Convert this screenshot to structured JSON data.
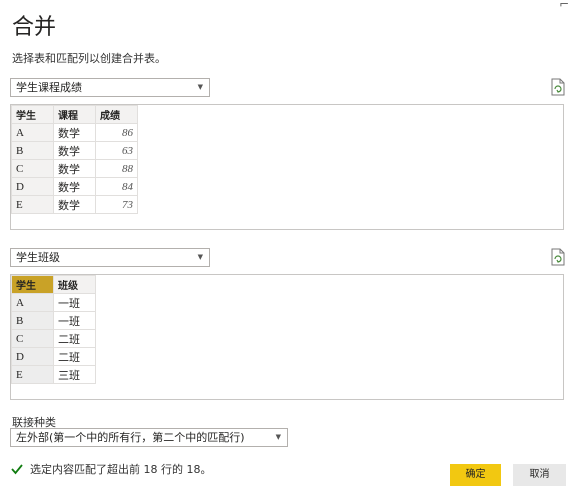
{
  "dialog": {
    "title": "合并",
    "subtitle": "选择表和匹配列以创建合并表。"
  },
  "table1": {
    "dropdown_value": "学生课程成绩",
    "columns": [
      "学生",
      "课程",
      "成绩"
    ],
    "rows": [
      [
        "A",
        "数学",
        "86"
      ],
      [
        "B",
        "数学",
        "63"
      ],
      [
        "C",
        "数学",
        "88"
      ],
      [
        "D",
        "数学",
        "84"
      ],
      [
        "E",
        "数学",
        "73"
      ]
    ]
  },
  "table2": {
    "dropdown_value": "学生班级",
    "columns": [
      "学生",
      "班级"
    ],
    "rows": [
      [
        "A",
        "一班"
      ],
      [
        "B",
        "一班"
      ],
      [
        "C",
        "二班"
      ],
      [
        "D",
        "二班"
      ],
      [
        "E",
        "三班"
      ]
    ]
  },
  "join": {
    "label": "联接种类",
    "value": "左外部(第一个中的所有行，第二个中的匹配行)"
  },
  "status": {
    "text": "选定内容匹配了超出前 18 行的 18。"
  },
  "buttons": {
    "ok": "确定",
    "cancel": "取消"
  },
  "colors": {
    "accent": "#f2c811",
    "selected_column": "#c9a227",
    "check": "#107c10"
  },
  "icons": {
    "refresh": "refresh-preview-icon",
    "check": "checkmark-icon",
    "close": "close-icon",
    "caret": "chevron-down-icon"
  }
}
